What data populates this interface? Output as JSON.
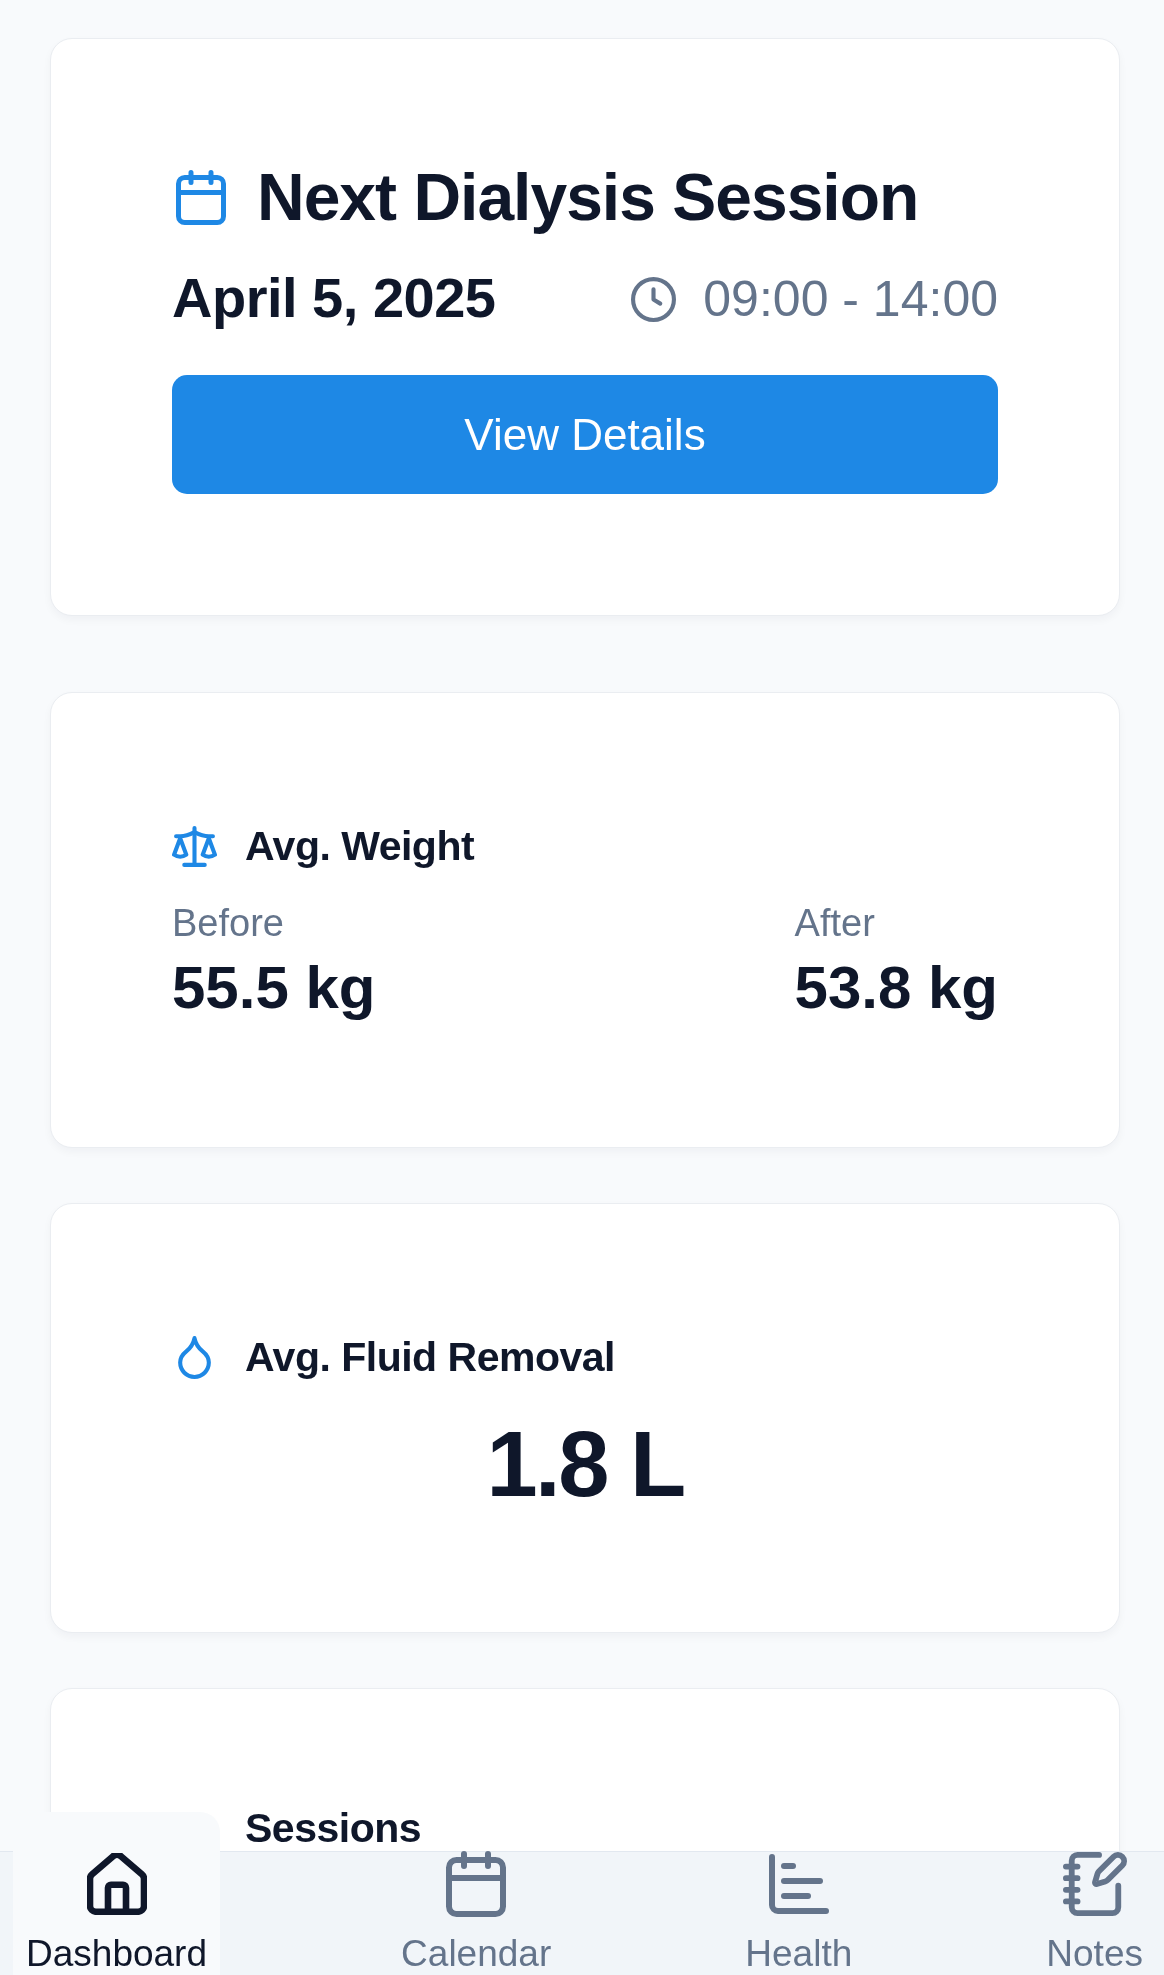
{
  "next_session": {
    "title": "Next Dialysis Session",
    "date": "April 5, 2025",
    "time": "09:00 - 14:00",
    "button": "View Details"
  },
  "stats": [
    {
      "kind": "pair",
      "title": "Avg. Weight",
      "items": [
        {
          "label": "Before",
          "value": "55.5 kg"
        },
        {
          "label": "After",
          "value": "53.8 kg"
        }
      ]
    },
    {
      "kind": "single",
      "title": "Avg. Fluid Removal",
      "value": "1.8 L"
    },
    {
      "kind": "header",
      "title": "Sessions"
    }
  ],
  "bottom_nav": {
    "items": [
      {
        "label": "Dashboard",
        "selected": true
      },
      {
        "label": "Calendar",
        "selected": false
      },
      {
        "label": "Health",
        "selected": false
      },
      {
        "label": "Notes",
        "selected": false
      }
    ]
  }
}
